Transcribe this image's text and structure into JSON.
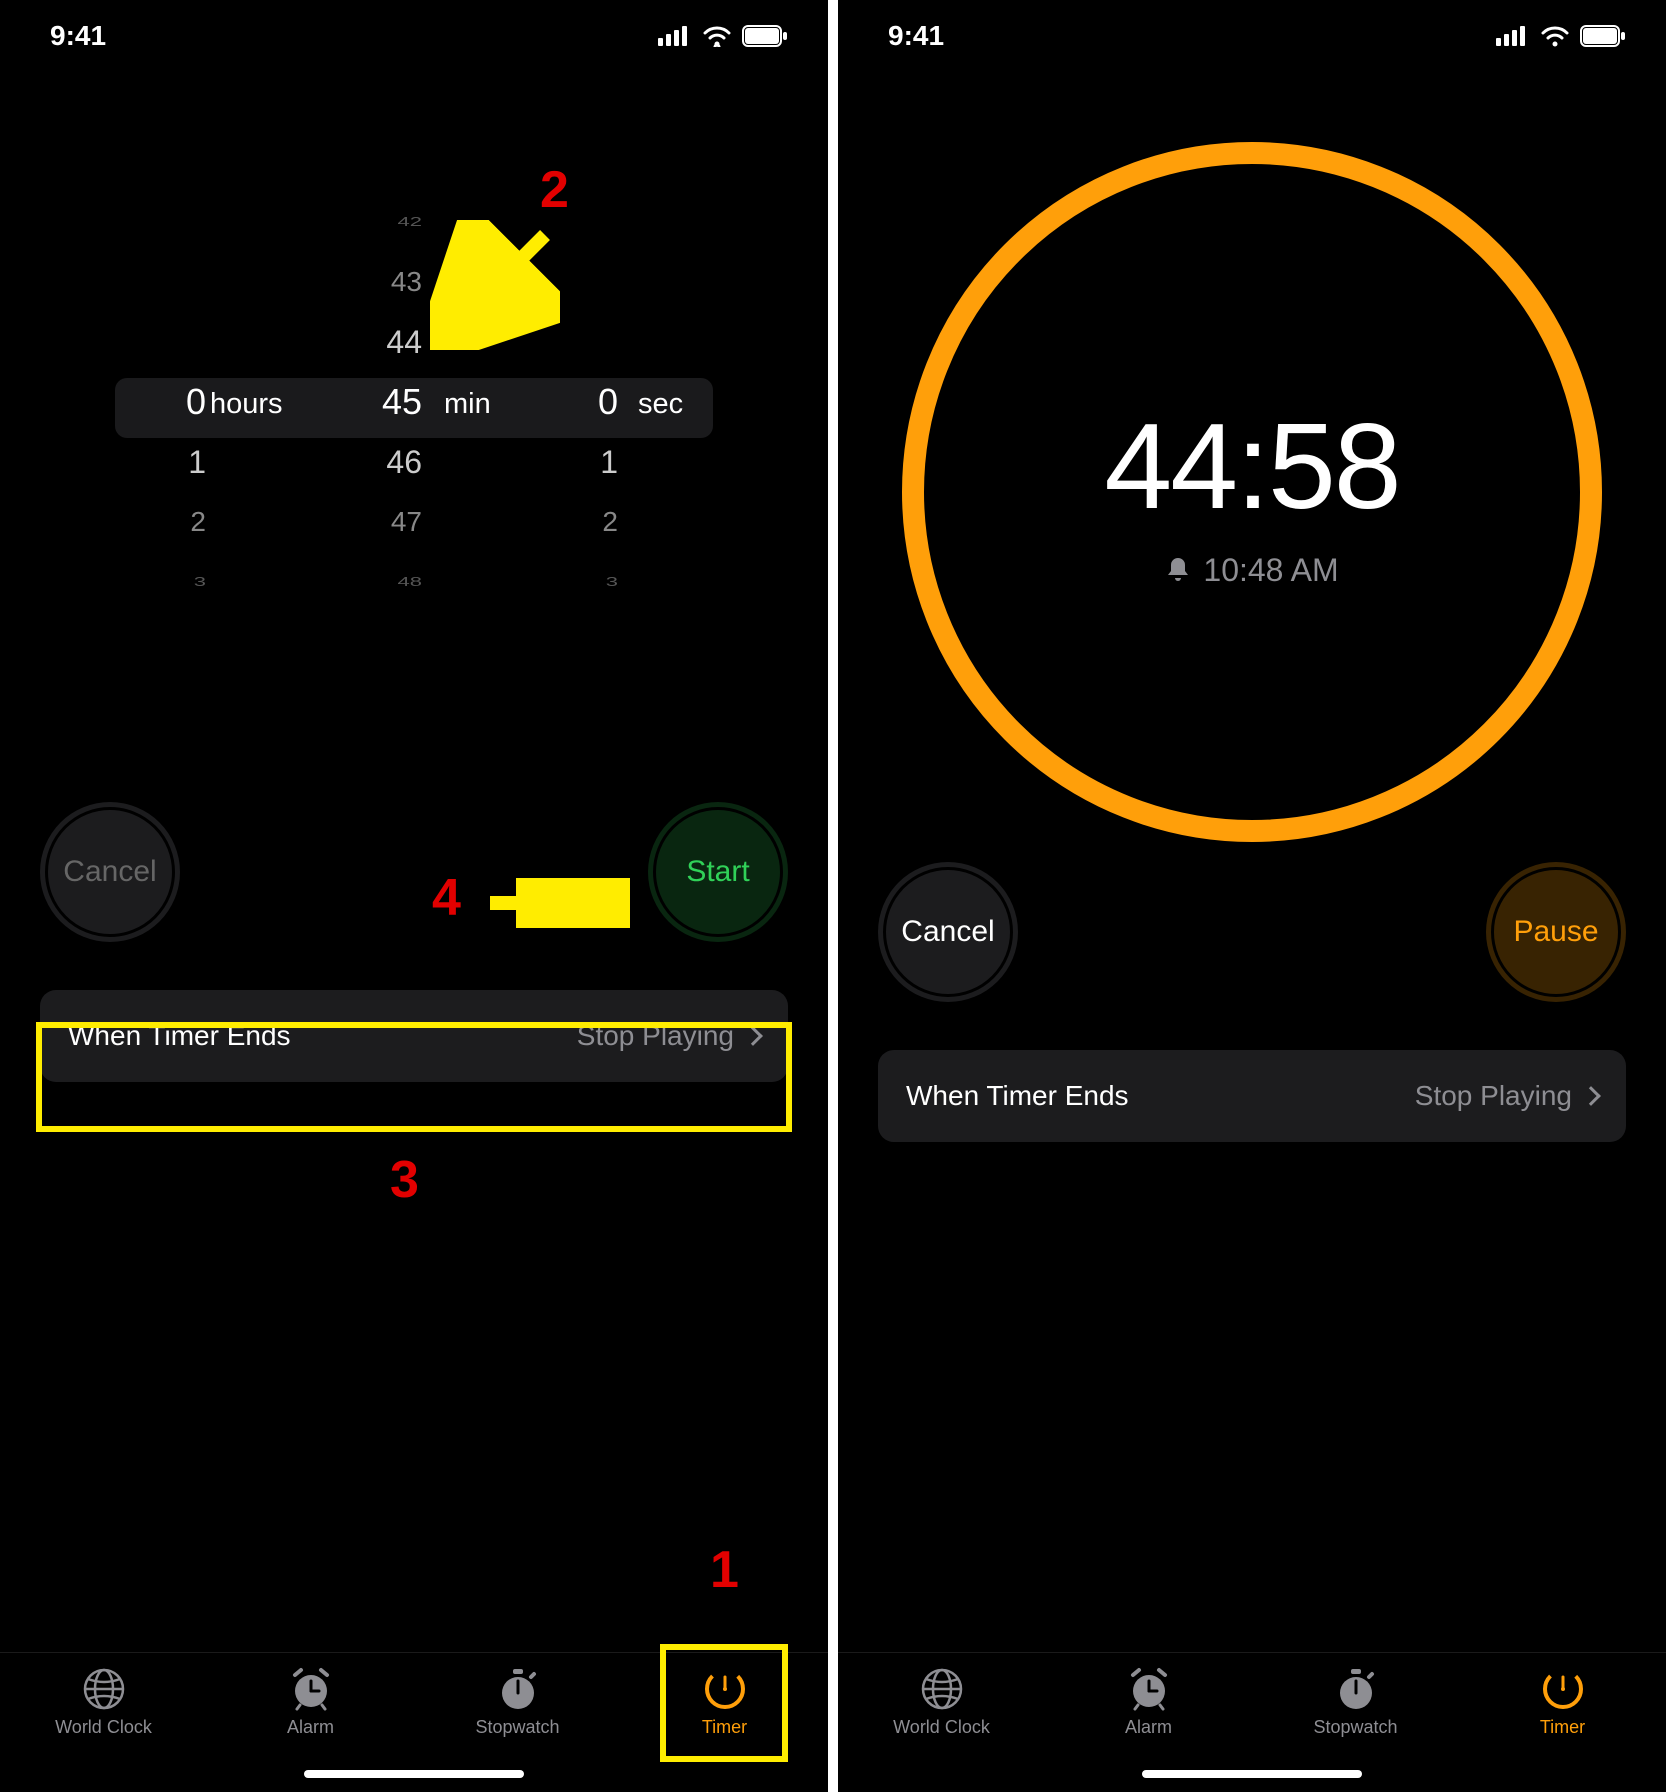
{
  "status": {
    "time": "9:41"
  },
  "picker": {
    "hours": {
      "label": "hours",
      "selected": "0",
      "below": [
        "1",
        "2",
        "3"
      ]
    },
    "min": {
      "label": "min",
      "selected": "45",
      "above": [
        "42",
        "43",
        "44"
      ],
      "below": [
        "46",
        "47",
        "48"
      ]
    },
    "sec": {
      "label": "sec",
      "selected": "0",
      "below": [
        "1",
        "2",
        "3"
      ]
    }
  },
  "buttons_left": {
    "cancel": "Cancel",
    "start": "Start"
  },
  "buttons_right": {
    "cancel": "Cancel",
    "pause": "Pause"
  },
  "row": {
    "label": "When Timer Ends",
    "value": "Stop Playing"
  },
  "running": {
    "remaining": "44:58",
    "ends_at": "10:48 AM"
  },
  "tabs": [
    {
      "label": "World Clock",
      "icon": "globe"
    },
    {
      "label": "Alarm",
      "icon": "alarm"
    },
    {
      "label": "Stopwatch",
      "icon": "stopwatch"
    },
    {
      "label": "Timer",
      "icon": "timer"
    }
  ],
  "annotations": {
    "n1": "1",
    "n2": "2",
    "n3": "3",
    "n4": "4"
  },
  "colors": {
    "orange": "#ff9f0a",
    "green": "#30d158",
    "yellow": "#ffed00",
    "red": "#e20000"
  }
}
